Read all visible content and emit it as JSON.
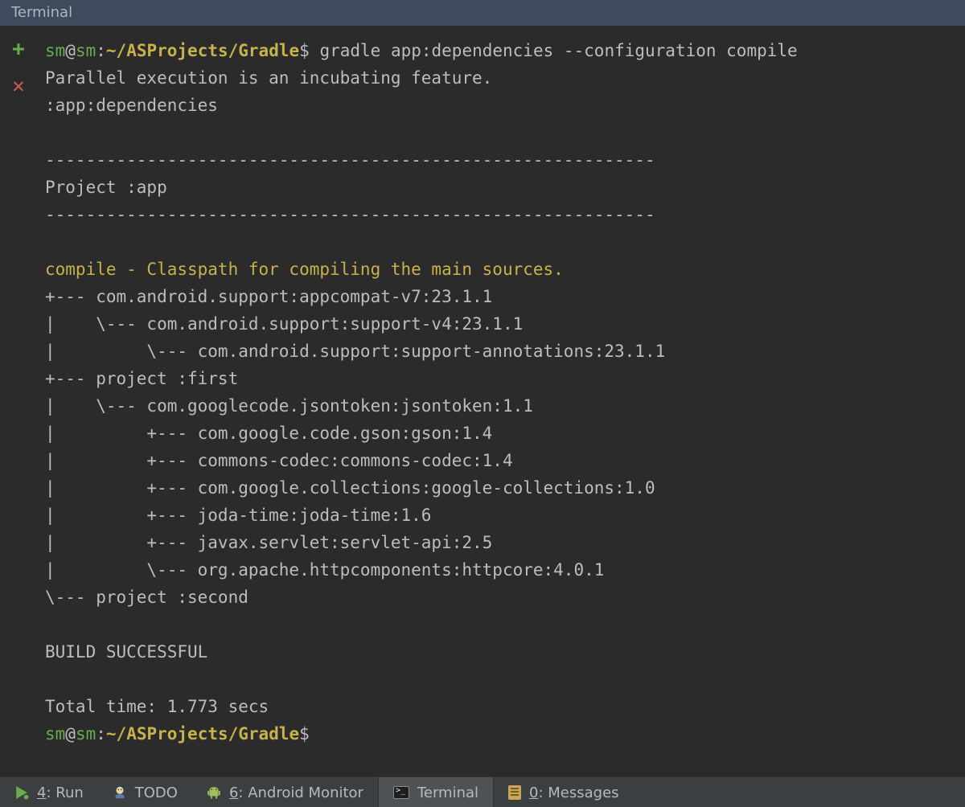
{
  "title_bar": {
    "label": "Terminal"
  },
  "gutter": {
    "add": {
      "glyph": "+"
    },
    "close": {
      "glyph": "✕"
    }
  },
  "prompt": {
    "user": "sm",
    "at": "@",
    "host": "sm",
    "colon": ":",
    "path": "~/ASProjects/Gradle",
    "dollar": "$"
  },
  "command": "gradle app:dependencies --configuration compile",
  "output": {
    "line_parallel": "Parallel execution is an incubating feature.",
    "line_task": ":app:dependencies",
    "blank": "",
    "hr": "------------------------------------------------------------",
    "line_project": "Project :app",
    "line_compile": "compile - Classpath for compiling the main sources.",
    "tree": [
      "+--- com.android.support:appcompat-v7:23.1.1",
      "|    \\--- com.android.support:support-v4:23.1.1",
      "|         \\--- com.android.support:support-annotations:23.1.1",
      "+--- project :first",
      "|    \\--- com.googlecode.jsontoken:jsontoken:1.1",
      "|         +--- com.google.code.gson:gson:1.4",
      "|         +--- commons-codec:commons-codec:1.4",
      "|         +--- com.google.collections:google-collections:1.0",
      "|         +--- joda-time:joda-time:1.6",
      "|         +--- javax.servlet:servlet-api:2.5",
      "|         \\--- org.apache.httpcomponents:httpcore:4.0.1",
      "\\--- project :second"
    ],
    "line_build": "BUILD SUCCESSFUL",
    "line_time": "Total time: 1.773 secs"
  },
  "bottom_tabs": {
    "run": {
      "pre": "",
      "u": "4",
      "post": ": Run"
    },
    "todo": {
      "pre": "TODO",
      "u": "",
      "post": ""
    },
    "monitor": {
      "pre": "",
      "u": "6",
      "post": ": Android Monitor"
    },
    "terminal": {
      "pre": "Terminal",
      "u": "",
      "post": ""
    },
    "messages": {
      "pre": "",
      "u": "0",
      "post": ": Messages"
    }
  }
}
